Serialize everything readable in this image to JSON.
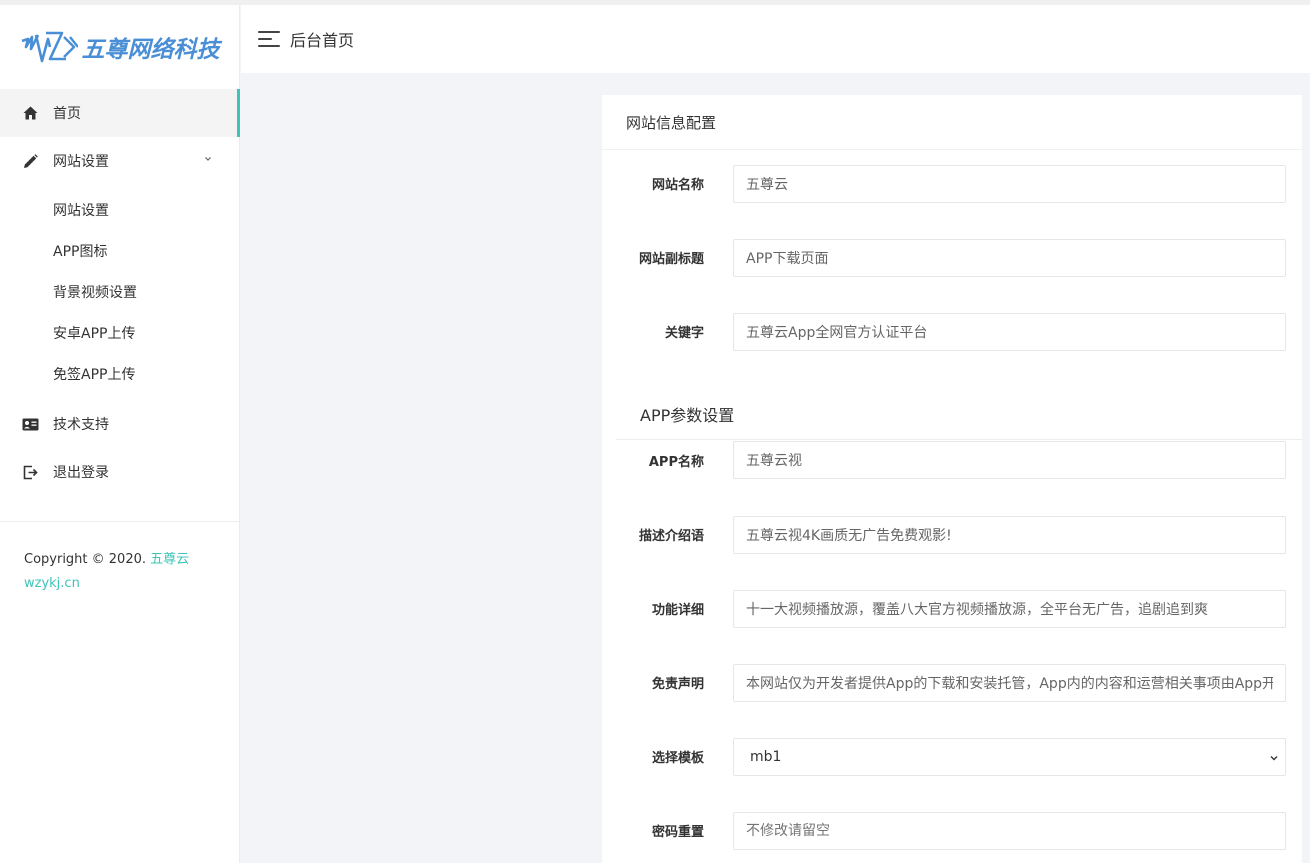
{
  "brand": {
    "logo_text": "五尊网络科技"
  },
  "header": {
    "title": "后台首页"
  },
  "sidebar": {
    "items": [
      {
        "label": "首页",
        "icon": "home-icon"
      },
      {
        "label": "网站设置",
        "icon": "pencil-icon"
      },
      {
        "label": "技术支持",
        "icon": "id-card-icon"
      },
      {
        "label": "退出登录",
        "icon": "logout-icon"
      }
    ],
    "subitems": [
      {
        "label": "网站设置"
      },
      {
        "label": "APP图标"
      },
      {
        "label": "背景视频设置"
      },
      {
        "label": "安卓APP上传"
      },
      {
        "label": "免签APP上传"
      }
    ]
  },
  "footer": {
    "copyright": "Copyright © 2020. ",
    "brand_link": "五尊云",
    "domain": "wzykj.cn"
  },
  "panel": {
    "title": "网站信息配置",
    "fields": {
      "site_name": {
        "label": "网站名称",
        "value": "五尊云"
      },
      "site_subtitle": {
        "label": "网站副标题",
        "value": "APP下载页面"
      },
      "keywords": {
        "label": "关键字",
        "value": "五尊云App全网官方认证平台"
      }
    },
    "app_section_title": "APP参数设置",
    "app_fields": {
      "app_name": {
        "label": "APP名称",
        "value": "五尊云视"
      },
      "description": {
        "label": "描述介绍语",
        "value": "五尊云视4K画质无广告免费观影!"
      },
      "features": {
        "label": "功能详细",
        "value": "十一大视频播放源，覆盖八大官方视频播放源，全平台无广告，追剧追到爽"
      },
      "disclaimer": {
        "label": "免责声明",
        "value": "本网站仅为开发者提供App的下载和安装托管，App内的内容和运营相关事项由App开发者负责"
      },
      "template": {
        "label": "选择模板",
        "value": "mb1"
      },
      "password": {
        "label": "密码重置",
        "placeholder": "不修改请留空"
      }
    }
  },
  "colors": {
    "accent": "#3ec4b8",
    "logo_blue": "#4a8fd6"
  }
}
